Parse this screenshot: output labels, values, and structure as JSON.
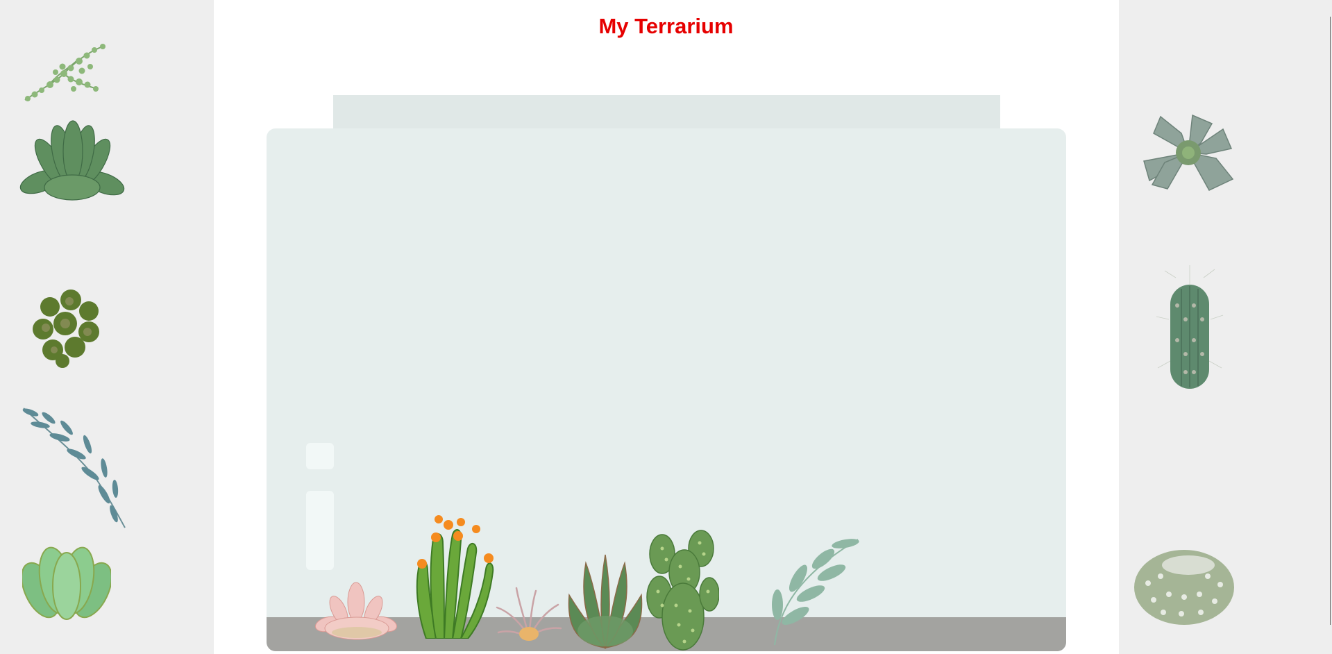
{
  "page": {
    "title": "My Terrarium"
  },
  "colors": {
    "title": "#e60000",
    "side_panel": "#eeeeee",
    "jar_glass": "#e6eeed",
    "jar_lid": "#e0e8e7",
    "dirt": "#a3a3a0"
  },
  "left_plants": [
    "string-of-pearls-plant",
    "echeveria-plant",
    "clustered-succulent-plant",
    "eucalyptus-branch-plant",
    "jade-succulent-plant"
  ],
  "right_plants": [
    "blue-echeveria-plant",
    "columnar-cactus-plant",
    "round-hairy-cactus-plant"
  ],
  "jar_plants": [
    "pink-succulent-plant",
    "flowering-cactus-plant",
    "air-plant",
    "aloe-plant",
    "prickly-pear-cactus-plant",
    "leafy-sprig-plant"
  ]
}
